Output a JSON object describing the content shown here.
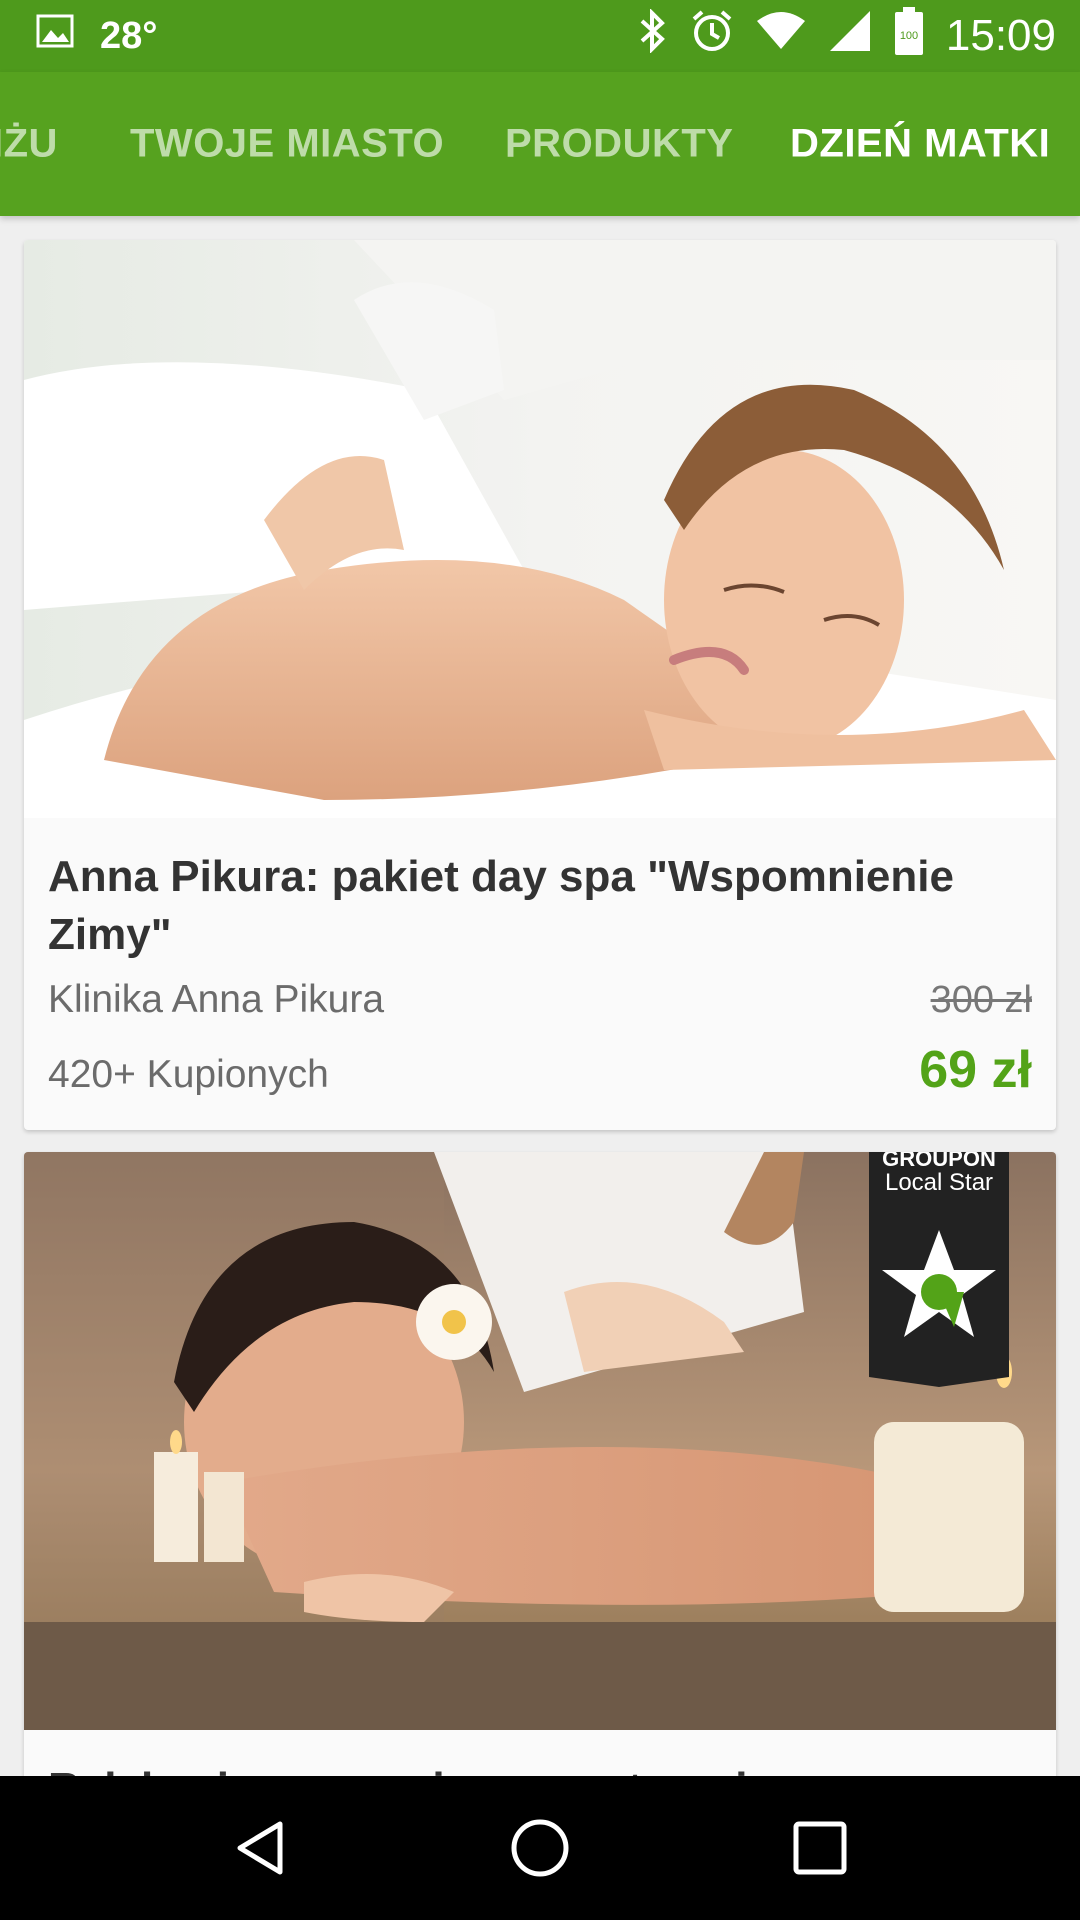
{
  "status_bar": {
    "temperature": "28°",
    "battery": "100",
    "time": "15:09"
  },
  "tabs": [
    {
      "label": "IŻU"
    },
    {
      "label": "TWOJE MIASTO"
    },
    {
      "label": "PRODUKTY"
    },
    {
      "label": "DZIEŃ MATKI",
      "active": true
    }
  ],
  "deals": [
    {
      "image_desc": "woman-back-massage",
      "title": "Anna Pikura: pakiet day spa \"Wspomnienie Zimy\"",
      "merchant": "Klinika Anna Pikura",
      "sold": "420+ Kupionych",
      "old_price": "300 zł",
      "new_price": "69 zł"
    },
    {
      "image_desc": "spa-oil-massage",
      "badge_brand": "GROUPON",
      "badge_text": "Local Star",
      "title": "Relaksujący masaż z aromaterapią"
    }
  ],
  "colors": {
    "status_bar": "#4e9a1c",
    "tab_bar": "#56a21f",
    "price_green": "#53a318"
  },
  "navigation": [
    "back",
    "home",
    "recents"
  ]
}
